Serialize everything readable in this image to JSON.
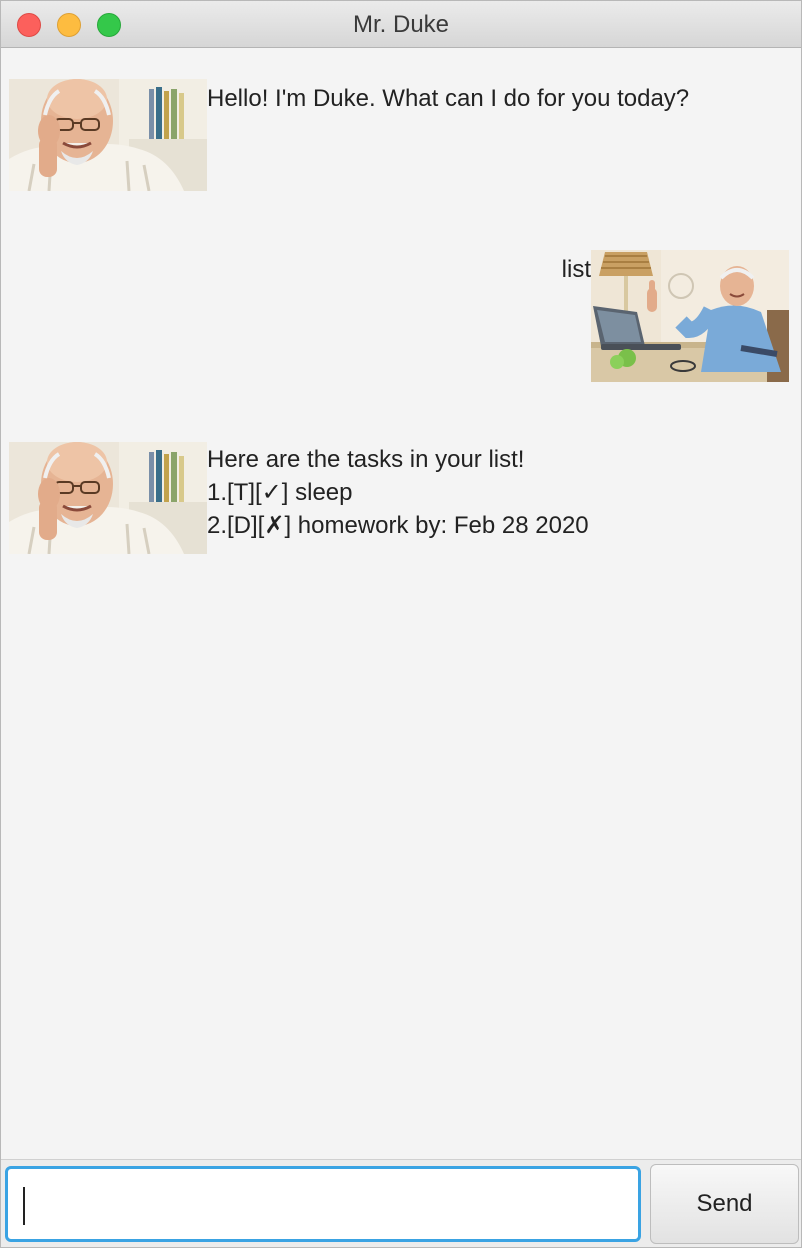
{
  "window": {
    "title": "Mr. Duke"
  },
  "dialog": [
    {
      "speaker": "duke",
      "lines": [
        "Hello! I'm Duke. What can I do for you today?"
      ]
    },
    {
      "speaker": "user",
      "lines": [
        "list"
      ]
    },
    {
      "speaker": "duke",
      "lines": [
        "Here are the tasks in your list!",
        "1.[T][✓] sleep",
        "2.[D][✗] homework by: Feb 28 2020"
      ]
    }
  ],
  "input": {
    "value": ""
  },
  "send_button": {
    "label": "Send"
  },
  "colors": {
    "close": "#fc605c",
    "minimize": "#fdbc40",
    "maximize": "#34c84a",
    "input_focus": "#3aa3e3",
    "background": "#f4f4f4"
  }
}
